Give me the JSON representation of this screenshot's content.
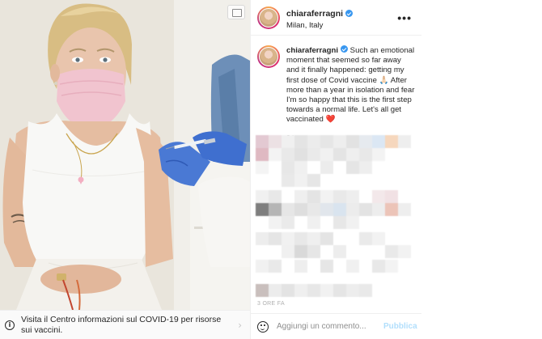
{
  "post": {
    "username": "chiaraferragni",
    "location": "Milan, Italy",
    "more_icon": "more-options-icon",
    "verified_icon": "verified-badge-icon"
  },
  "caption": {
    "username": "chiaraferragni",
    "text": " Such an emotional moment that seemed so far away and it finally happened: getting my first dose of Covid vaccine 🙏🏻 After more than a year in isolation and fear I'm so happy that this is the first step towards a normal life. Let's all get vaccinated ",
    "emoji": "❤️",
    "time_ago": "3 h"
  },
  "covid_banner": {
    "text": "Visita il Centro informazioni sul COVID-19 per risorse sui vaccini.",
    "chevron": "›",
    "icon": "info-icon"
  },
  "comment_box": {
    "placeholder": "Aggiungi un commento...",
    "publish_label": "Pubblica",
    "emoji_icon": "emoji-icon"
  },
  "footer": {
    "timestamp": "3 ORE FA"
  },
  "colors": {
    "link_blue": "#3897f0",
    "publish_disabled": "#b2dffc",
    "secondary_text": "#8e8e8e",
    "heart": "#e0245e"
  }
}
